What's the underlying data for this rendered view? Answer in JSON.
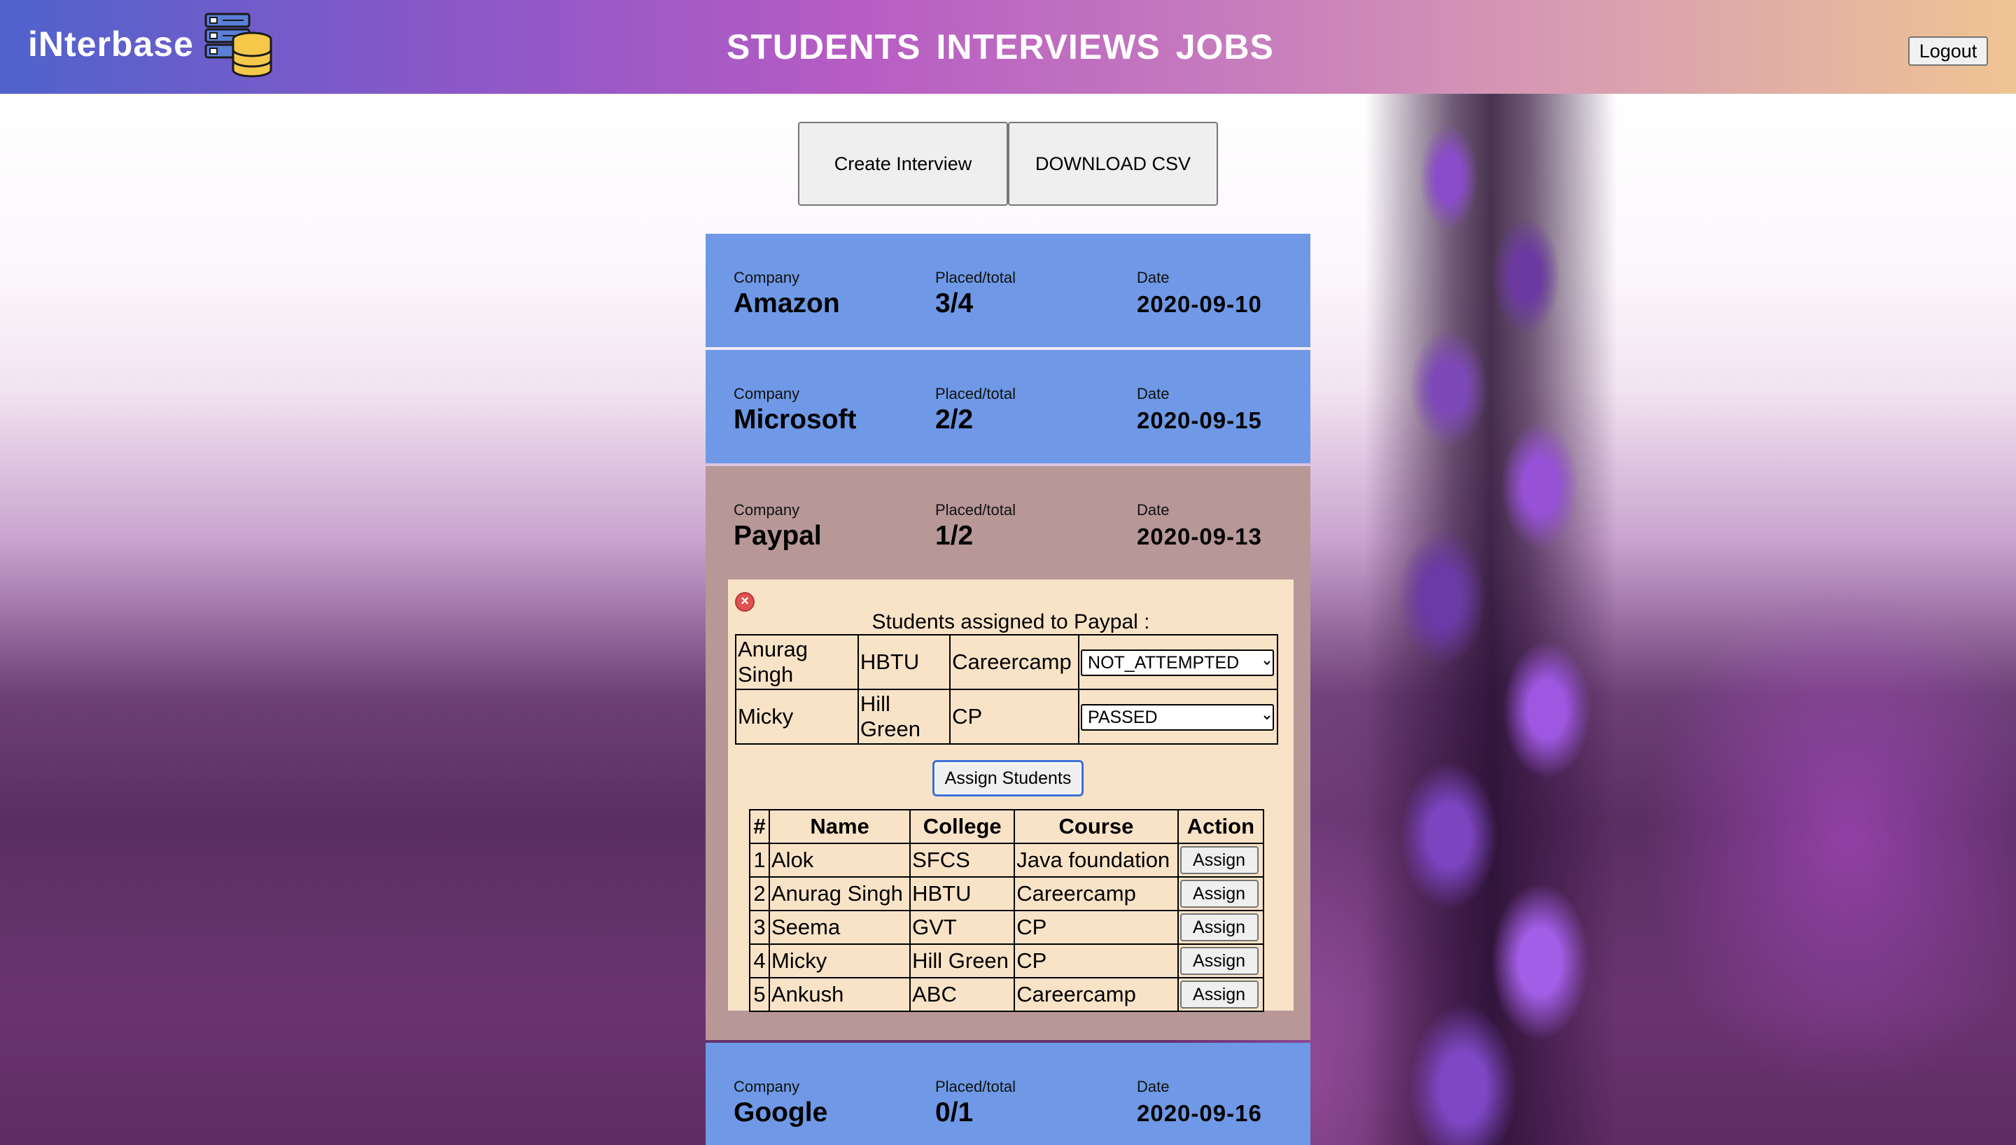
{
  "header": {
    "brand": "iNterbase",
    "nav": [
      "STUDENTS",
      "INTERVIEWS",
      "JOBS"
    ],
    "logout_label": "Logout",
    "gradient_colors": [
      "#4f63cc",
      "#b65cc4",
      "#efc493"
    ]
  },
  "actions": {
    "create_label": "Create Interview",
    "csv_label": "DOWNLOAD CSV"
  },
  "labels": {
    "company": "Company",
    "placed": "Placed/total",
    "date": "Date"
  },
  "interviews": [
    {
      "company": "Amazon",
      "placed": "3/4",
      "date": "2020-09-10"
    },
    {
      "company": "Microsoft",
      "placed": "2/2",
      "date": "2020-09-15"
    },
    {
      "company": "Paypal",
      "placed": "1/2",
      "date": "2020-09-13"
    },
    {
      "company": "Google",
      "placed": "0/1",
      "date": "2020-09-16"
    }
  ],
  "expanded": {
    "title": "Students assigned to Paypal :",
    "assigned": [
      {
        "name": "Anurag Singh",
        "college": "HBTU",
        "course": "Careercamp",
        "status": "NOT_ATTEMPTED"
      },
      {
        "name": "Micky",
        "college": "Hill Green",
        "course": "CP",
        "status": "PASSED"
      }
    ],
    "assign_label": "Assign Students",
    "columns": [
      "#",
      "Name",
      "College",
      "Course",
      "Action"
    ],
    "students": [
      {
        "num": "1",
        "name": "Alok",
        "college": "SFCS",
        "course": "Java foundation",
        "action": "Assign"
      },
      {
        "num": "2",
        "name": "Anurag Singh",
        "college": "HBTU",
        "course": "Careercamp",
        "action": "Assign"
      },
      {
        "num": "3",
        "name": "Seema",
        "college": "GVT",
        "course": "CP",
        "action": "Assign"
      },
      {
        "num": "4",
        "name": "Micky",
        "college": "Hill Green",
        "course": "CP",
        "action": "Assign"
      },
      {
        "num": "5",
        "name": "Ankush",
        "college": "ABC",
        "course": "Careercamp",
        "action": "Assign"
      }
    ]
  },
  "icons": {
    "logo": "server-database-icon",
    "close": "close-icon"
  }
}
